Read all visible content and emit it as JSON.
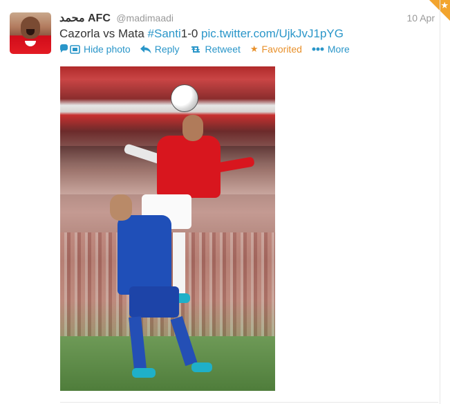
{
  "tweet": {
    "fullname": "محمد AFC",
    "username": "@madimaadi",
    "timestamp": "10 Apr",
    "text_plain": "Cazorla vs Mata ",
    "hashtag": "#Santi",
    "text_after_hashtag": "1-0 ",
    "link": "pic.twitter.com/UjkJvJ1pYG"
  },
  "actions": {
    "hide_photo": "Hide photo",
    "reply": "Reply",
    "retweet": "Retweet",
    "favorited": "Favorited",
    "more": "More"
  },
  "icons": {
    "hide_photo": "photo-icon",
    "reply": "reply-arrow-icon",
    "retweet": "retweet-icon",
    "favorited": "star-icon",
    "more": "ellipsis-icon",
    "corner": "favorite-corner-star-icon"
  },
  "colors": {
    "link": "#2a96c9",
    "favorited": "#e8902a",
    "corner": "#f2a42e"
  }
}
